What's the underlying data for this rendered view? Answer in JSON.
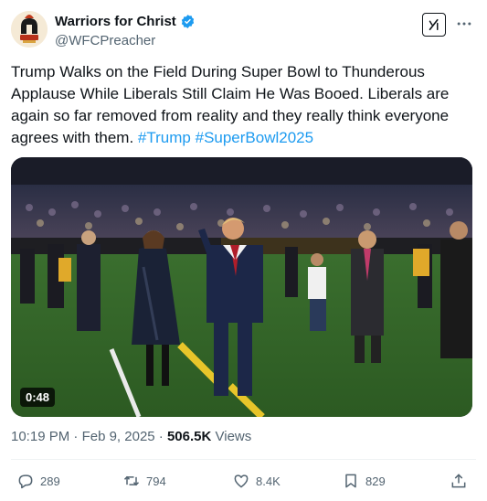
{
  "author": {
    "name": "Warriors for Christ",
    "handle": "@WFCPreacher",
    "verified": true,
    "avatar_icon": "spartan-helmet-logo"
  },
  "toolbar": {
    "grok_icon": "grok-icon",
    "more_icon": "more-icon"
  },
  "tweet": {
    "text": "Trump Walks on the Field During Super Bowl to Thunderous Applause While Liberals Still Claim He Was Booed. Liberals are again so far removed from reality and they really think everyone agrees with them.",
    "hashtags": [
      "#Trump",
      "#SuperBowl2025"
    ]
  },
  "media": {
    "duration": "0:48"
  },
  "meta": {
    "time": "10:19 PM",
    "separator": "·",
    "date": "Feb 9, 2025",
    "views_count": "506.5K",
    "views_label": "Views"
  },
  "actions": {
    "replies": "289",
    "reposts": "794",
    "likes": "8.4K",
    "bookmarks": "829"
  },
  "colors": {
    "accent": "#1d9bf0",
    "text": "#0f1419",
    "secondary": "#536471"
  }
}
